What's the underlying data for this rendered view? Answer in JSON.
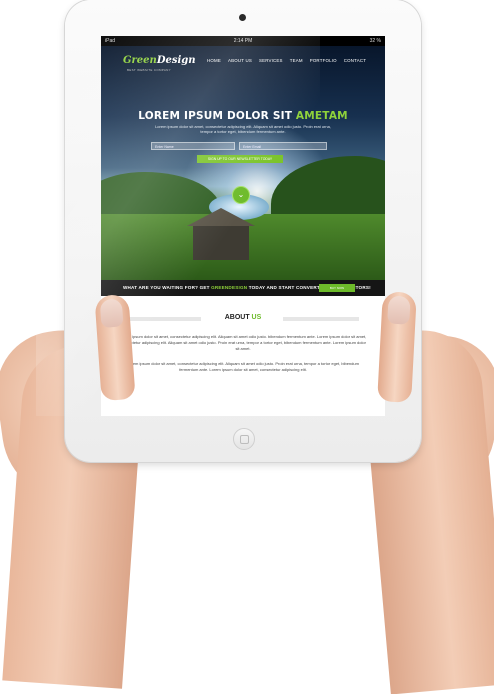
{
  "status_bar": {
    "device": "iPad",
    "time": "2:14 PM",
    "battery": "32 %"
  },
  "nav": {
    "logo_green": "Green",
    "logo_white": "Design",
    "logo_tagline": "BEST WEBSITE COMPANY",
    "items": [
      "HOME",
      "ABOUT US",
      "SERVICES",
      "TEAM",
      "PORTFOLIO",
      "CONTACT"
    ]
  },
  "hero": {
    "title_main": "LOREM IPSUM DOLOR SIT ",
    "title_accent": "AMETAM",
    "subtitle": "Lorem ipsum dolor sit amet, consectetur adipiscing elit. Aliquam sit amet odio justo. Proin erat urna, tempor a tortor eget, bibendum fermentum ante.",
    "name_placeholder": "Enter Name",
    "email_placeholder": "Enter Email",
    "signup_label": "SIGN UP TO OUR NEWSLETTER TODAY",
    "scroll_icon": "chevron-down-icon"
  },
  "cta": {
    "text_before": "WHAT ARE YOU WAITING FOR? GET ",
    "text_accent": "GREENDESIGN",
    "text_after": " TODAY AND START CONVERTING MORE VISITORS!",
    "button": "BUY NOW"
  },
  "about": {
    "title_main": "ABOUT ",
    "title_accent": "US",
    "p1": "Lorem ipsum dolor sit amet, consectetur adipiscing elit. Aliquam sit amet odio justo. bibendum fermentum ante. Lorem ipsum dolor sit amet, consectetur adipiscing elit. Aliquam sit amet odio justo. Proin erat urna, tempor a tortor eget, bibendum fermentum ante. Lorem ipsum dolor sit amet.",
    "p2": "Lorem ipsum dolor sit amet, consectetur adipiscing elit. Aliquam sit amet odio justo. Proin erat urna, tempor a tortor eget, bibendum fermentum ante. Lorem ipsum dolor sit amet, consectetur adipiscing elit."
  },
  "colors": {
    "accent": "#7cc42c",
    "dark_bar": "#151515"
  }
}
